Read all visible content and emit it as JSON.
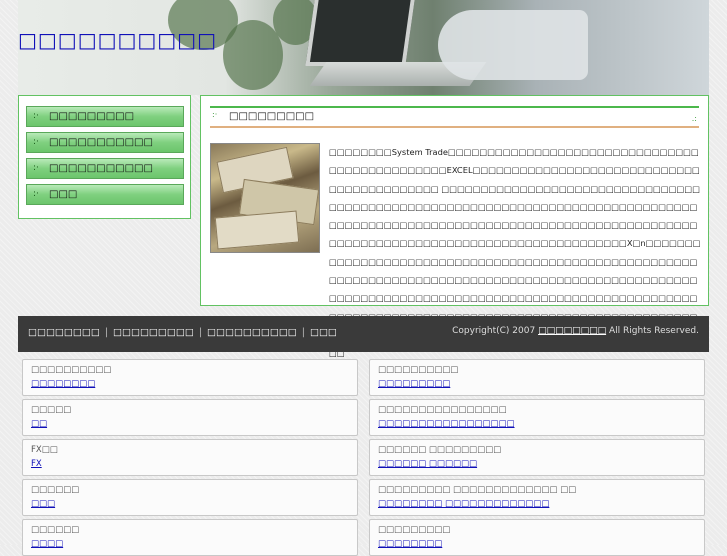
{
  "header": {
    "title": "□□□□□□□□□□"
  },
  "sidebar": {
    "items": [
      {
        "label": "□□□□□□□□□"
      },
      {
        "label": "□□□□□□□□□□□"
      },
      {
        "label": "□□□□□□□□□□□"
      },
      {
        "label": "□□□"
      }
    ]
  },
  "content": {
    "heading": "□□□□□□□□□",
    "body": "□□□□□□□□System Trade□□□□□□□□□□□□□□□□□□□□□□□□□□□□□□□□□□□□□□□□□□□□□□□EXCEL□□□□□□□□□□□□□□□□□□□□□□□□□□□□□□□□□□□□□□□□□□□ □□□□□□□□□□□□□□□□□□□□□□□□□□□□□□□□□□□□□□□□□□□□□□□□□□□□□□□□□□□□□□□□□□□□□□□□□□□□□□□□□□□□□□□□□□□□□□□□□□□□□□□□□□□□□□□□□□□□□□□□□□□□□□□□□□□□□□□□□□□□□□□□□□□□□□□□□□□□□□□□□□□□□X□n□□□□□□□□□□□□□□□□□□□□□□□□□□□□□□□□□□□□□□□□□□□□□□□□□□□□□□□□□□□□□□□□□□□□□□□□□□□□□□□□□□□□□□□□□□□□□□□□□□□□□□□□□□□□□□□□□□□□□□□□□□□□□□□□□□□□□□□□□□□□□□□□□□□□□□□□□□□□□□□□□□□□□□□□□□□□□□□□□□□□□□□□□□□□□□□□□□□□□□□□□□□□□□□□□□□□□□□□□□□□□□□□□□□□□□□□□□□□□□□□□□□□"
  },
  "footer": {
    "links": [
      "□□□□□□□□",
      "□□□□□□□□□",
      "□□□□□□□□□□",
      "□□□"
    ],
    "separator": "|",
    "copyright_prefix": "Copyright(C) 2007",
    "copyright_link": "□□□□□□□□",
    "copyright_suffix": "All Rights Reserved."
  },
  "link_boxes": [
    {
      "title": "□□□□□□□□□□",
      "url": "□□□□□□□□"
    },
    {
      "title": "□□□□□□□□□□",
      "url": "□□□□□□□□□"
    },
    {
      "title": "□□□□□",
      "url": "□□"
    },
    {
      "title": "□□□□□□□□□□□□□□□□",
      "url": "□□□□□□□□□□□□□□□□□"
    },
    {
      "title": "FX□□",
      "url": "FX"
    },
    {
      "title": "□□□□□□ □□□□□□□□□",
      "url": "□□□□□□ □□□□□□"
    },
    {
      "title": "□□□□□□",
      "url": "□□□"
    },
    {
      "title": "□□□□□□□□□ □□□□□□□□□□□□□ □□",
      "url": "□□□□□□□□ □□□□□□□□□□□□□"
    },
    {
      "title": "□□□□□□",
      "url": "□□□□"
    },
    {
      "title": "□□□□□□□□□",
      "url": "□□□□□□□□"
    }
  ]
}
